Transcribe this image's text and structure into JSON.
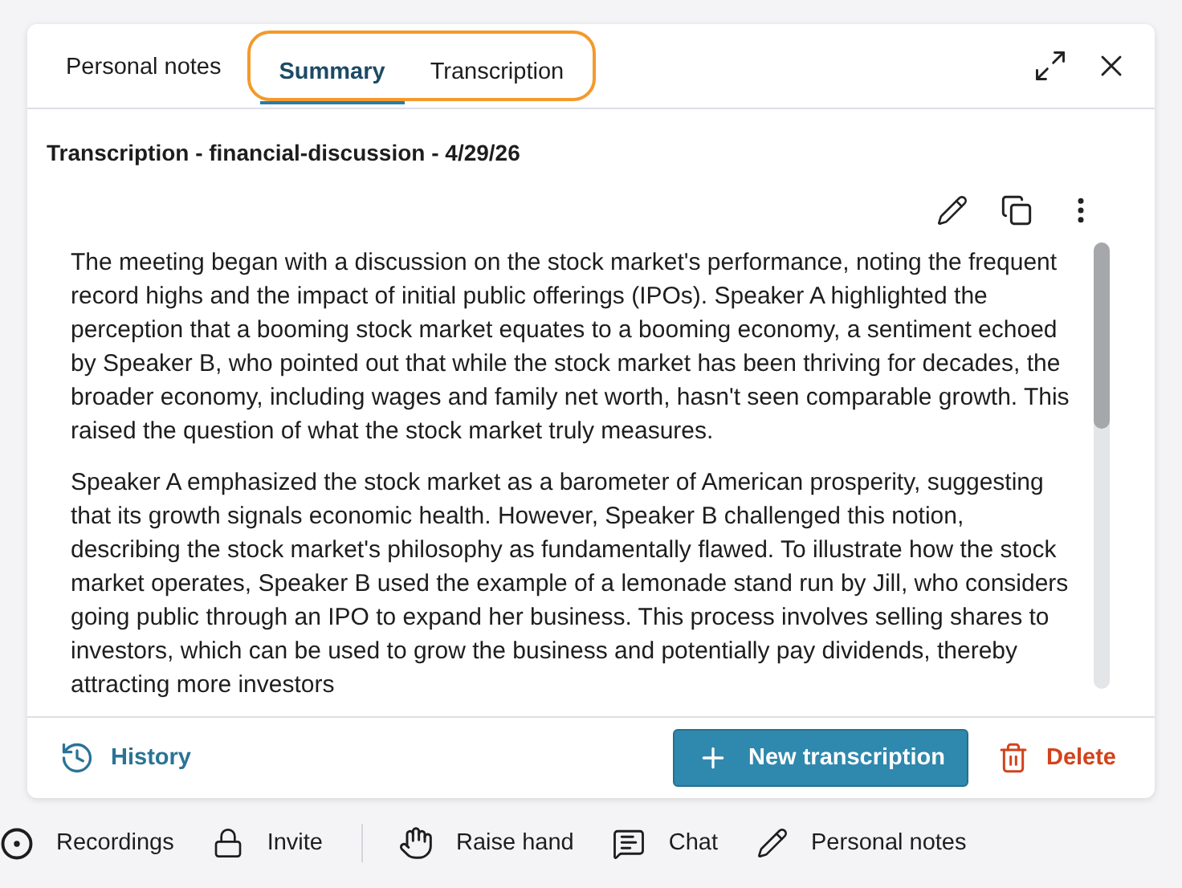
{
  "panel": {
    "tabs": [
      {
        "label": "Personal notes",
        "selected": false,
        "highlighted": false
      },
      {
        "label": "Summary",
        "selected": true,
        "highlighted": true
      },
      {
        "label": "Transcription",
        "selected": false,
        "highlighted": true
      }
    ],
    "heading": "Transcription - financial-discussion - 4/29/26",
    "paragraphs": [
      "The meeting began with a discussion on the stock market's performance, noting the frequent record highs and the impact of initial public offerings (IPOs). Speaker A highlighted the perception that a booming stock market equates to a booming economy, a sentiment echoed by Speaker B, who pointed out that while the stock market has been thriving for decades, the broader economy, including wages and family net worth, hasn't seen comparable growth. This raised the question of what the stock market truly measures.",
      "Speaker A emphasized the stock market as a barometer of American prosperity, suggesting that its growth signals economic health. However, Speaker B challenged this notion, describing the stock market's philosophy as fundamentally flawed. To illustrate how the stock market operates, Speaker B used the example of a lemonade stand run by Jill, who considers going public through an IPO to expand her business. This process involves selling shares to investors, which can be used to grow the business and potentially pay dividends, thereby attracting more investors"
    ],
    "history": "History",
    "new_button": "New transcription",
    "delete_button": "Delete"
  },
  "toolbar": [
    {
      "kind": "record",
      "label": "Recordings",
      "separator_before": false
    },
    {
      "kind": "lock",
      "label": "Invite",
      "separator_before": false
    },
    {
      "kind": "hand",
      "label": "Raise hand",
      "separator_before": true
    },
    {
      "kind": "chat",
      "label": "Chat",
      "separator_before": false
    },
    {
      "kind": "pencil",
      "label": "Personal notes",
      "separator_before": false
    }
  ]
}
